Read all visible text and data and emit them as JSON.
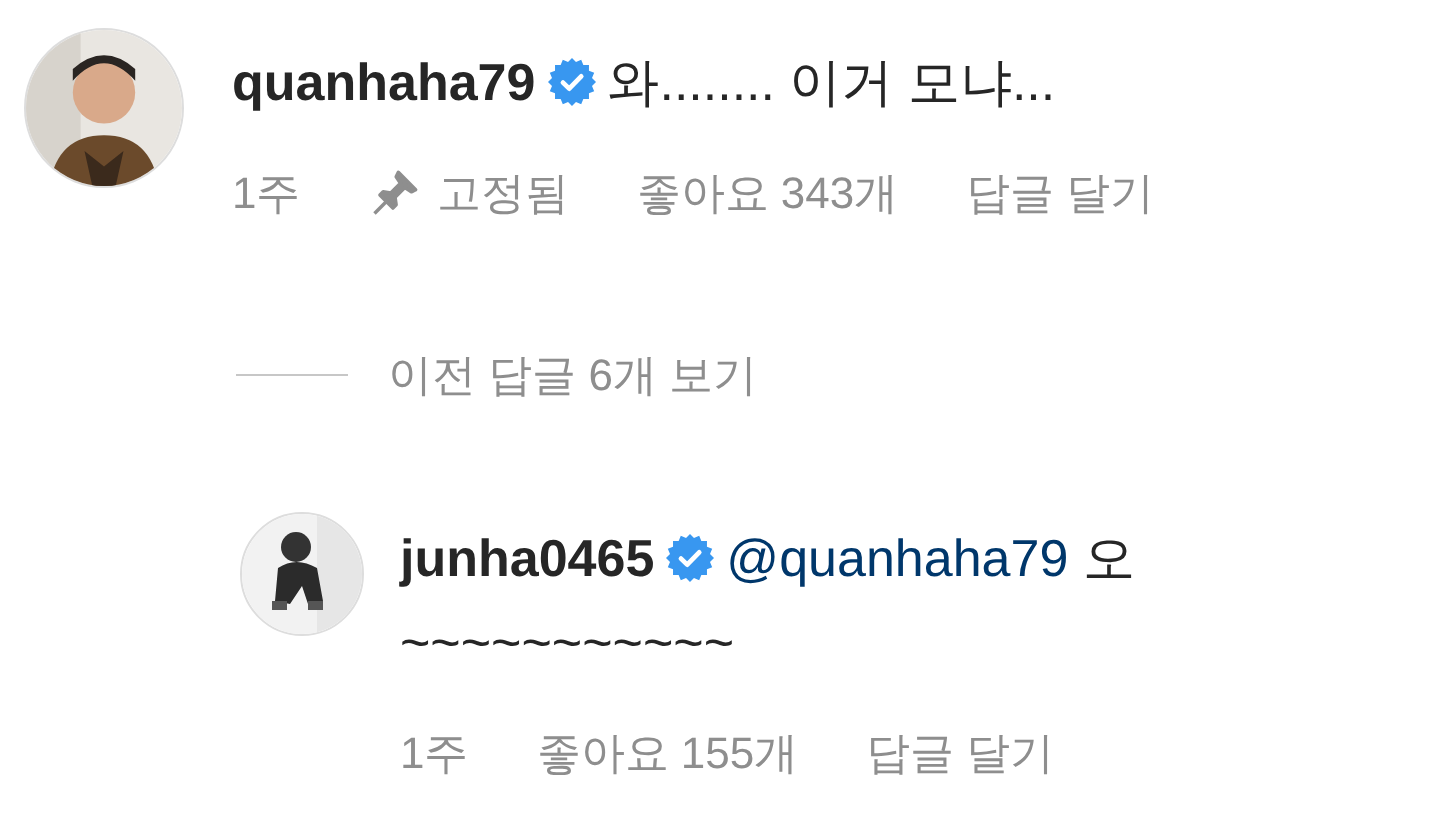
{
  "comments": [
    {
      "username": "quanhaha79",
      "verified": true,
      "text_lines": [
        "와........ 이거 모냐..."
      ],
      "time": "1주",
      "pinned": true,
      "pinned_label": "고정됨",
      "likes": "좋아요 343개",
      "reply_action": "답글 달기"
    }
  ],
  "view_replies": "이전 답글 6개 보기",
  "replies": [
    {
      "username": "junha0465",
      "verified": true,
      "mention": "@quanhaha79",
      "text_lines": [
        "오",
        "~~~~~~~~~~~"
      ],
      "time": "1주",
      "pinned": false,
      "likes": "좋아요 155개",
      "reply_action": "답글 달기"
    }
  ]
}
